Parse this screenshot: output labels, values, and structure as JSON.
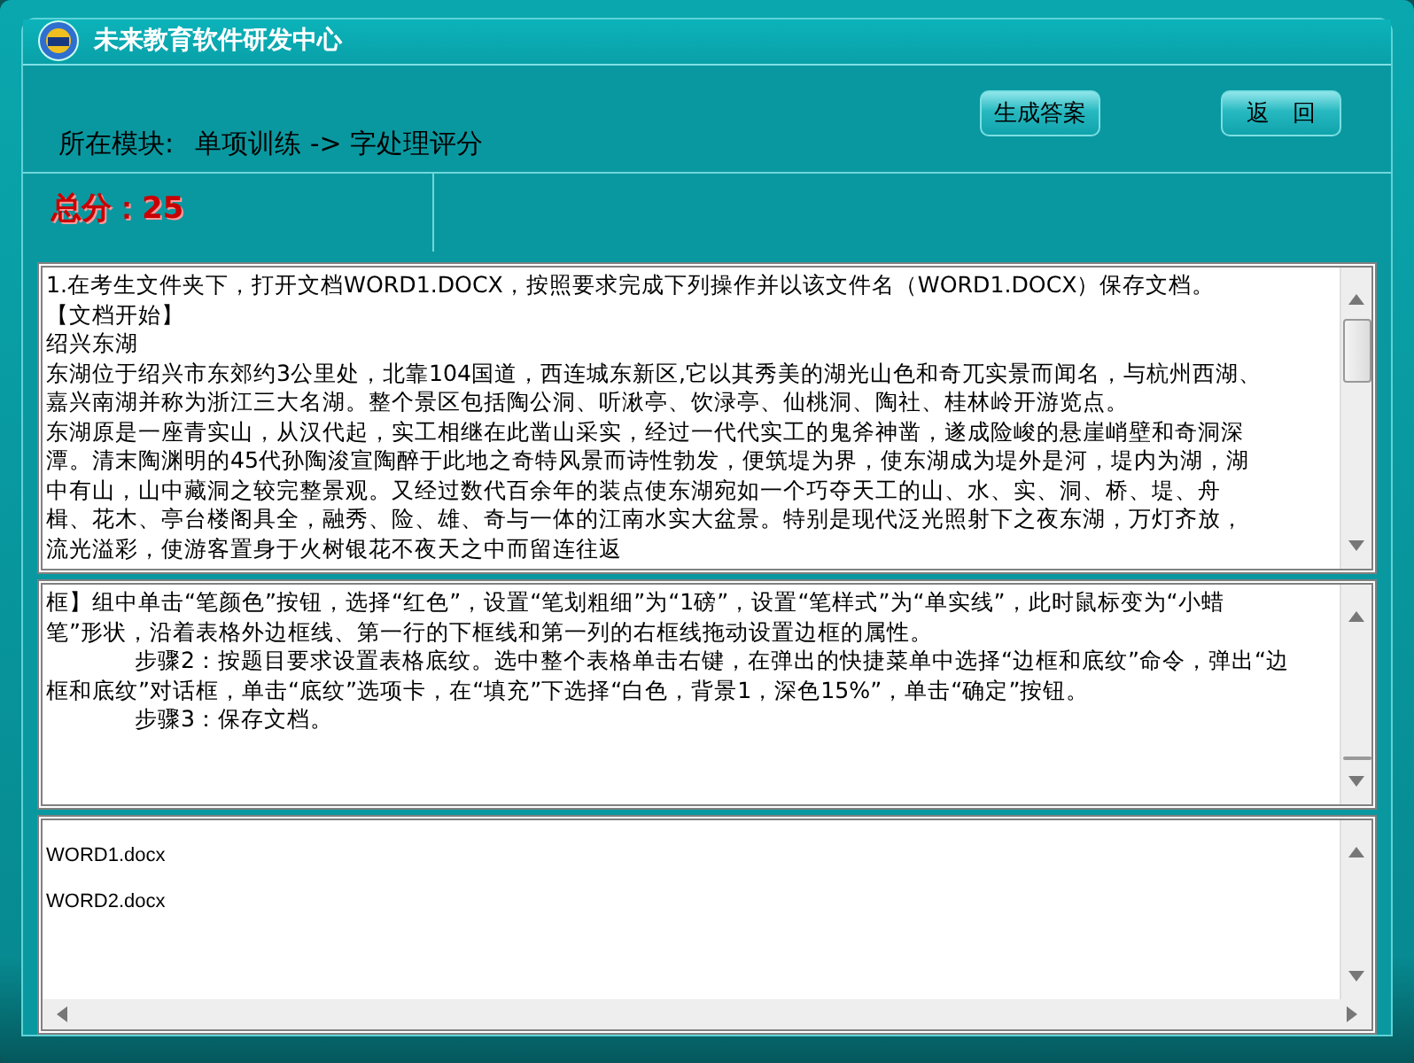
{
  "window": {
    "title": "未来教育软件研发中心"
  },
  "header": {
    "module_label": "所在模块:",
    "module_path": "单项训练 -> 字处理评分",
    "buttons": [
      {
        "label": "生成答案"
      },
      {
        "label": "返　回"
      }
    ]
  },
  "score": {
    "label": "总分：",
    "value": "25"
  },
  "question_panel": {
    "lines": [
      {
        "text": "1.在考生文件夹下，打开文档WORD1.DOCX，按照要求完成下列操作并以该文件名（WORD1.DOCX）保存文档。",
        "indent": false
      },
      {
        "text": "【文档开始】",
        "indent": false
      },
      {
        "text": "绍兴东湖",
        "indent": false
      },
      {
        "text": "东湖位于绍兴市东郊约3公里处，北靠104国道，西连城东新区,它以其秀美的湖光山色和奇兀实景而闻名，与杭州西湖、",
        "indent": false
      },
      {
        "text": "嘉兴南湖并称为浙江三大名湖。整个景区包括陶公洞、听湫亭、饮渌亭、仙桃洞、陶社、桂林岭开游览点。",
        "indent": false
      },
      {
        "text": "东湖原是一座青实山，从汉代起，实工相继在此凿山采实，经过一代代实工的鬼斧神凿，遂成险峻的悬崖峭壁和奇洞深",
        "indent": false
      },
      {
        "text": "潭。清末陶渊明的45代孙陶浚宣陶醉于此地之奇特风景而诗性勃发，便筑堤为界，使东湖成为堤外是河，堤内为湖，湖",
        "indent": false
      },
      {
        "text": "中有山，山中藏洞之较完整景观。又经过数代百余年的装点使东湖宛如一个巧夺天工的山、水、实、洞、桥、堤、舟",
        "indent": false
      },
      {
        "text": "楫、花木、亭台楼阁具全，融秀、险、雄、奇与一体的江南水实大盆景。特别是现代泛光照射下之夜东湖，万灯齐放，",
        "indent": false
      },
      {
        "text": "流光溢彩，使游客置身于火树银花不夜天之中而留连往返",
        "indent": false
      }
    ]
  },
  "answer_panel": {
    "lines": [
      {
        "text": "框】组中单击“笔颜色”按钮，选择“红色”，设置“笔划粗细”为“1磅”，设置“笔样式”为“单实线”，此时鼠标变为“小蜡",
        "indent": false
      },
      {
        "text": "笔”形状，沿着表格外边框线、第一行的下框线和第一列的右框线拖动设置边框的属性。",
        "indent": false
      },
      {
        "text": "步骤2：按题目要求设置表格底纹。选中整个表格单击右键，在弹出的快捷菜单中选择“边框和底纹”命令，弹出“边",
        "indent": true
      },
      {
        "text": "框和底纹”对话框，单击“底纹”选项卡，在“填充”下选择“白色，背景1，深色15%”，单击“确定”按钮。",
        "indent": false
      },
      {
        "text": "步骤3：保存文档。",
        "indent": true
      }
    ]
  },
  "files": [
    "WORD1.docx",
    "WORD2.docx"
  ]
}
